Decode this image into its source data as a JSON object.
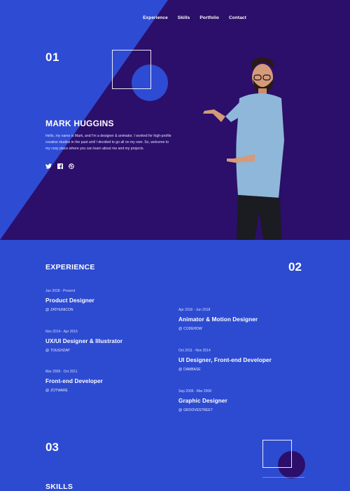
{
  "nav": [
    "Experience",
    "Skills",
    "Portfolio",
    "Contact"
  ],
  "hero": {
    "number": "01",
    "name": "MARK HUGGINS",
    "bio": "Hello, my name is Mark, and I'm a designer & animator. I worked for high-profile creative studios in the past until I decided to go all on my own. So, welcome to my cosy place where you can learn about me and my projects.",
    "socials": [
      "twitter-icon",
      "facebook-icon",
      "dribbble-icon"
    ]
  },
  "experience": {
    "title": "EXPERIENCE",
    "number": "02",
    "jobs": [
      {
        "dates": "Jun 2018 - Present",
        "role": "Product Designer",
        "company": "ZATHUNICON"
      },
      {
        "dates": "Nov 2014 - Apr 2016",
        "role": "UX/UI Designer & Illustrator",
        "company": "TOUGHZAP"
      },
      {
        "dates": "Mar 2008 - Oct 2011",
        "role": "Front-end Developer",
        "company": "ZOTWARE"
      },
      {
        "dates": "Apr 2016 - Jun 2018",
        "role": "Animator & Motion Designer",
        "company": "CODEHOW"
      },
      {
        "dates": "Oct 2011 - Nov 2014",
        "role": "UI Designer, Front-end Developer",
        "company": "DAMBASE"
      },
      {
        "dates": "Sep 2006 - Mar 2008",
        "role": "Graphic Designer",
        "company": "GROOVESTREET"
      }
    ]
  },
  "skills": {
    "number": "03",
    "title": "SKILLS"
  },
  "colors": {
    "blue": "#2e4bd3",
    "purple": "#2b0f6a"
  }
}
